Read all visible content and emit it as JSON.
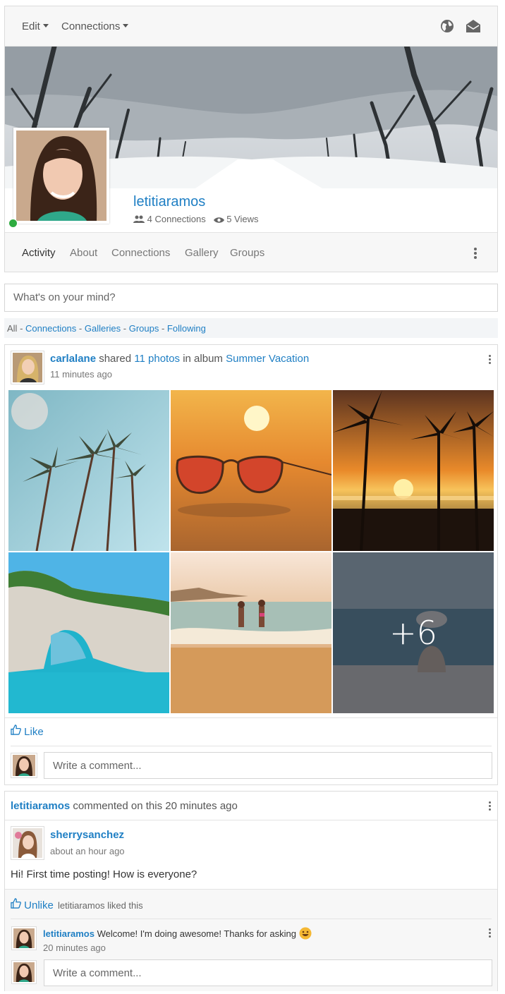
{
  "topbar": {
    "edit_label": "Edit",
    "connections_label": "Connections",
    "icons": [
      "globe-icon",
      "envelope-open-icon"
    ]
  },
  "profile": {
    "username": "letitiaramos",
    "connections_text": "4 Connections",
    "views_text": "5 Views",
    "online": true
  },
  "profile_nav": {
    "items": [
      "Activity",
      "About",
      "Connections",
      "Gallery",
      "Groups"
    ],
    "active": "Activity"
  },
  "status": {
    "placeholder": "What's on your mind?"
  },
  "filters": {
    "all": "All",
    "sep": " - ",
    "links": [
      "Connections",
      "Galleries",
      "Groups",
      "Following"
    ]
  },
  "post": {
    "author": "carlalane",
    "action": "shared",
    "count_link": "11 photos",
    "in_album": "in album",
    "album": "Summer Vacation",
    "time": "11 minutes ago",
    "more_count": "+6",
    "like_label": "Like",
    "comment_placeholder": "Write a comment..."
  },
  "comment_activity": {
    "actor": "letitiaramos",
    "text": "commented on this 20 minutes ago",
    "original_author": "sherrysanchez",
    "original_time": "about an hour ago",
    "original_body": "Hi! First time posting! How is everyone?",
    "unlike_label": "Unlike",
    "liked_text": "letitiaramos liked this",
    "reply_author": "letitiaramos",
    "reply_body": "Welcome! I'm doing awesome! Thanks for asking",
    "reply_time": "20 minutes ago",
    "comment_placeholder": "Write a comment..."
  },
  "colors": {
    "link": "#1f7fc4",
    "online": "#2eab3f"
  }
}
